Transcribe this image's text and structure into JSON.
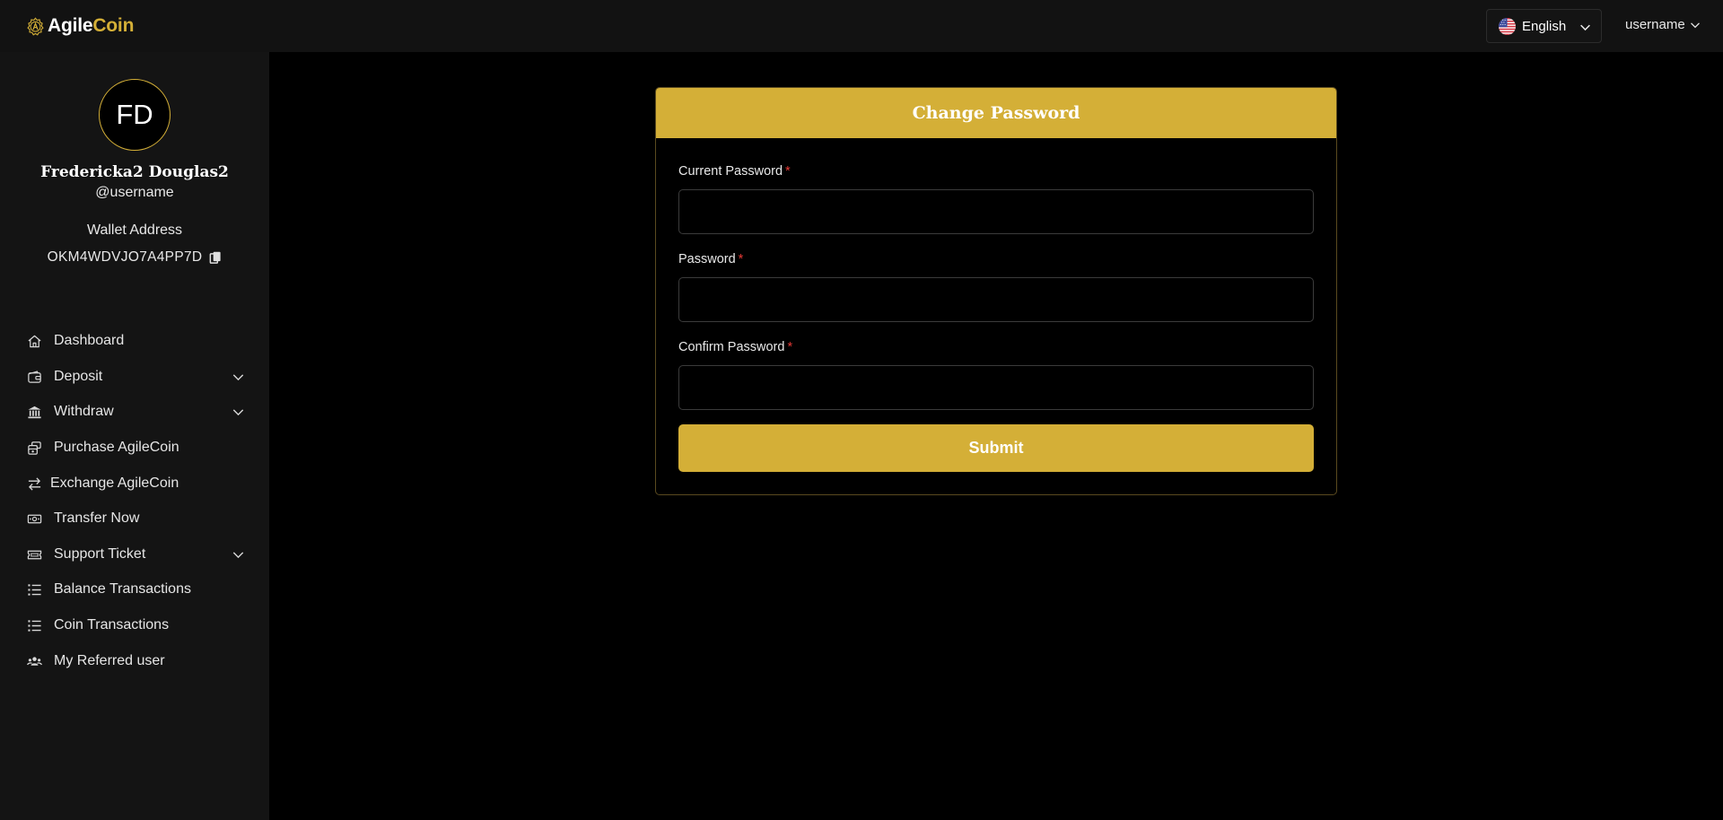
{
  "brand": {
    "part1": "Agile",
    "part2": "Coin",
    "accent": "#d4af37"
  },
  "header": {
    "language": {
      "label": "English",
      "flag": "us-flag-icon"
    },
    "user_menu": {
      "label": "username"
    }
  },
  "profile": {
    "initials": "FD",
    "name": "Fredericka2 Douglas2",
    "handle": "@username",
    "wallet_label": "Wallet Address",
    "wallet_address": "OKM4WDVJO7A4PP7D"
  },
  "sidebar": {
    "items": [
      {
        "label": "Dashboard",
        "icon": "home-icon",
        "expandable": false
      },
      {
        "label": "Deposit",
        "icon": "wallet-icon",
        "expandable": true
      },
      {
        "label": "Withdraw",
        "icon": "bank-icon",
        "expandable": true
      },
      {
        "label": "Purchase AgileCoin",
        "icon": "coins-icon",
        "expandable": false
      },
      {
        "label": "Exchange AgileCoin",
        "icon": "exchange-icon",
        "expandable": false
      },
      {
        "label": "Transfer Now",
        "icon": "money-transfer-icon",
        "expandable": false
      },
      {
        "label": "Support Ticket",
        "icon": "ticket-icon",
        "expandable": true
      },
      {
        "label": "Balance Transactions",
        "icon": "list-icon",
        "expandable": false
      },
      {
        "label": "Coin Transactions",
        "icon": "list-icon",
        "expandable": false
      },
      {
        "label": "My Referred user",
        "icon": "users-icon",
        "expandable": false
      }
    ]
  },
  "form": {
    "title": "Change Password",
    "fields": [
      {
        "label": "Current Password",
        "required_mark": "*",
        "value": "",
        "placeholder": ""
      },
      {
        "label": "Password",
        "required_mark": "*",
        "value": "",
        "placeholder": ""
      },
      {
        "label": "Confirm Password",
        "required_mark": "*",
        "value": "",
        "placeholder": ""
      }
    ],
    "submit_label": "Submit"
  }
}
